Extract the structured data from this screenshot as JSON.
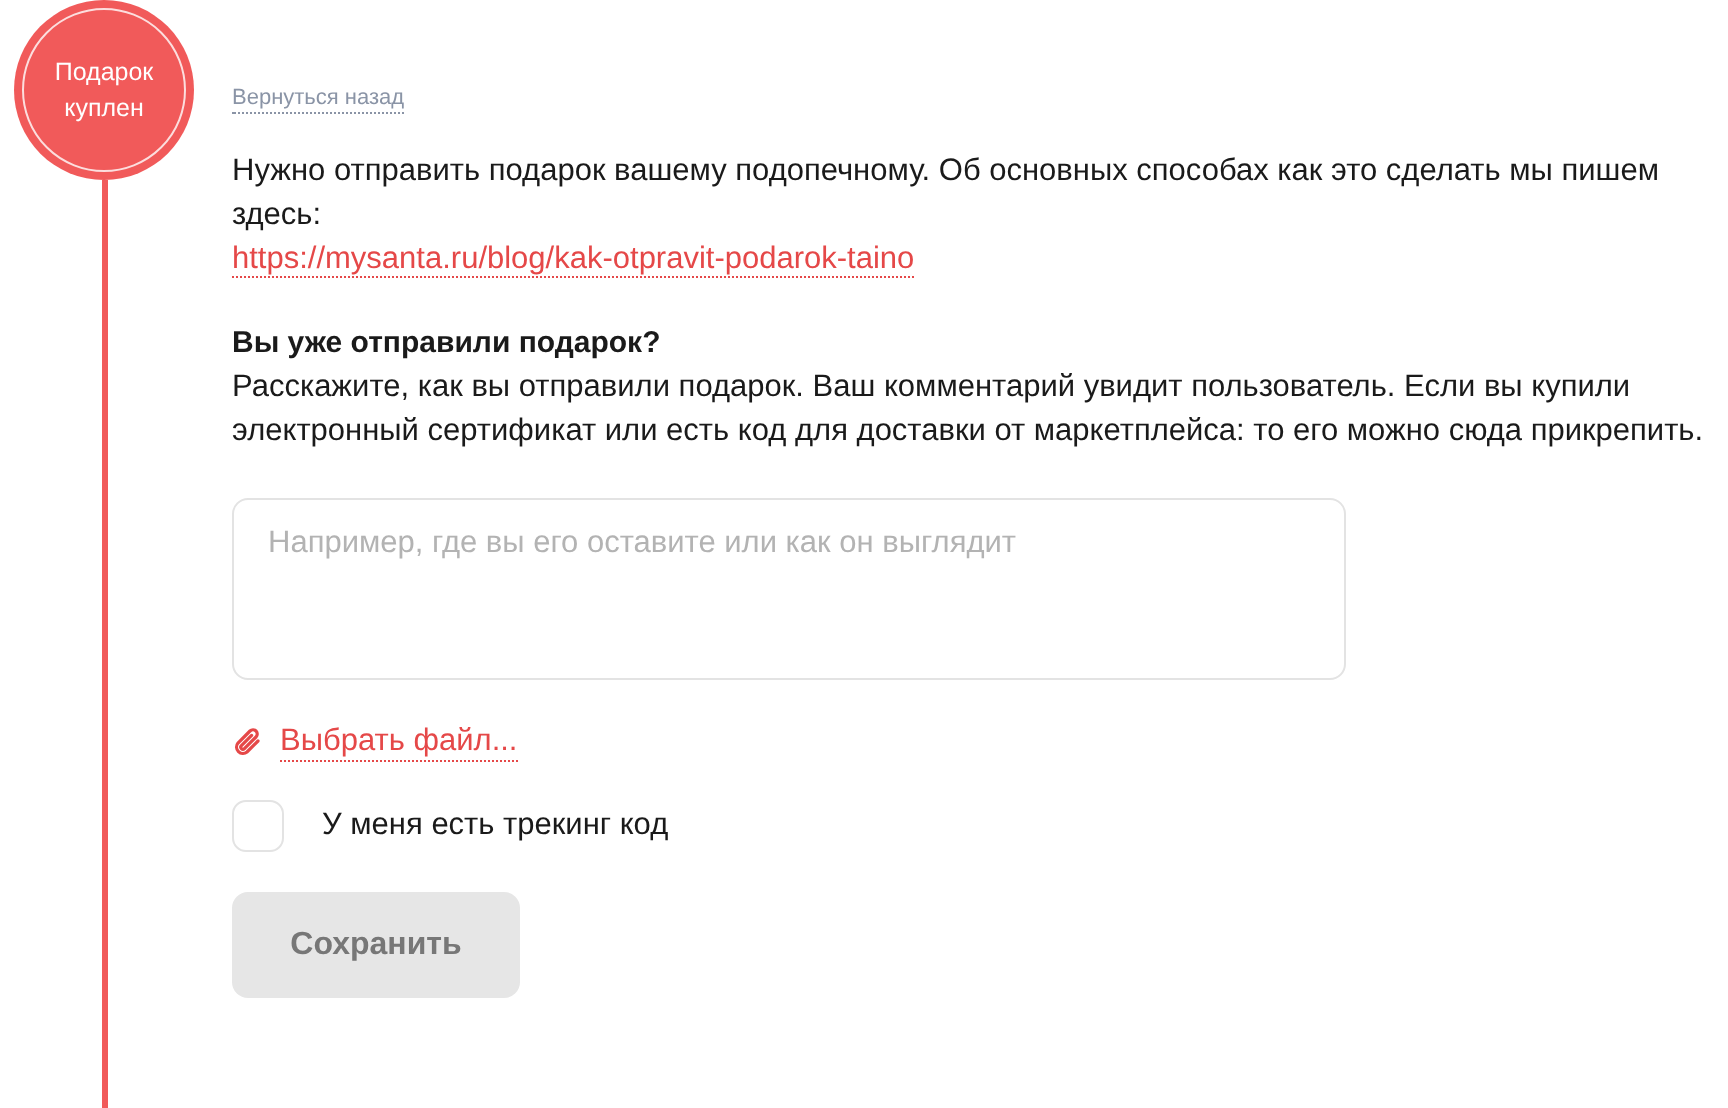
{
  "status_badge": {
    "label": "Подарок куплен"
  },
  "back_link": "Вернуться назад",
  "intro": {
    "text": "Нужно отправить подарок вашему подопечному. Об основных способах как это сделать мы пишем здесь:",
    "link": "https://mysanta.ru/blog/kak-otpravit-podarok-taino"
  },
  "question": {
    "title": "Вы уже отправили подарок?",
    "description": "Расскажите, как вы отправили подарок. Ваш комментарий увидит пользователь. Если вы купили электронный сертификат или есть код для доставки от маркетплейса: то его можно сюда прикрепить."
  },
  "comment_field": {
    "placeholder": "Например, где вы его оставите или как он выглядит"
  },
  "attach_link": "Выбрать файл...",
  "tracking_checkbox": {
    "label": "У меня есть трекинг код",
    "checked": false
  },
  "save_button": {
    "label": "Сохранить",
    "disabled": true
  }
}
